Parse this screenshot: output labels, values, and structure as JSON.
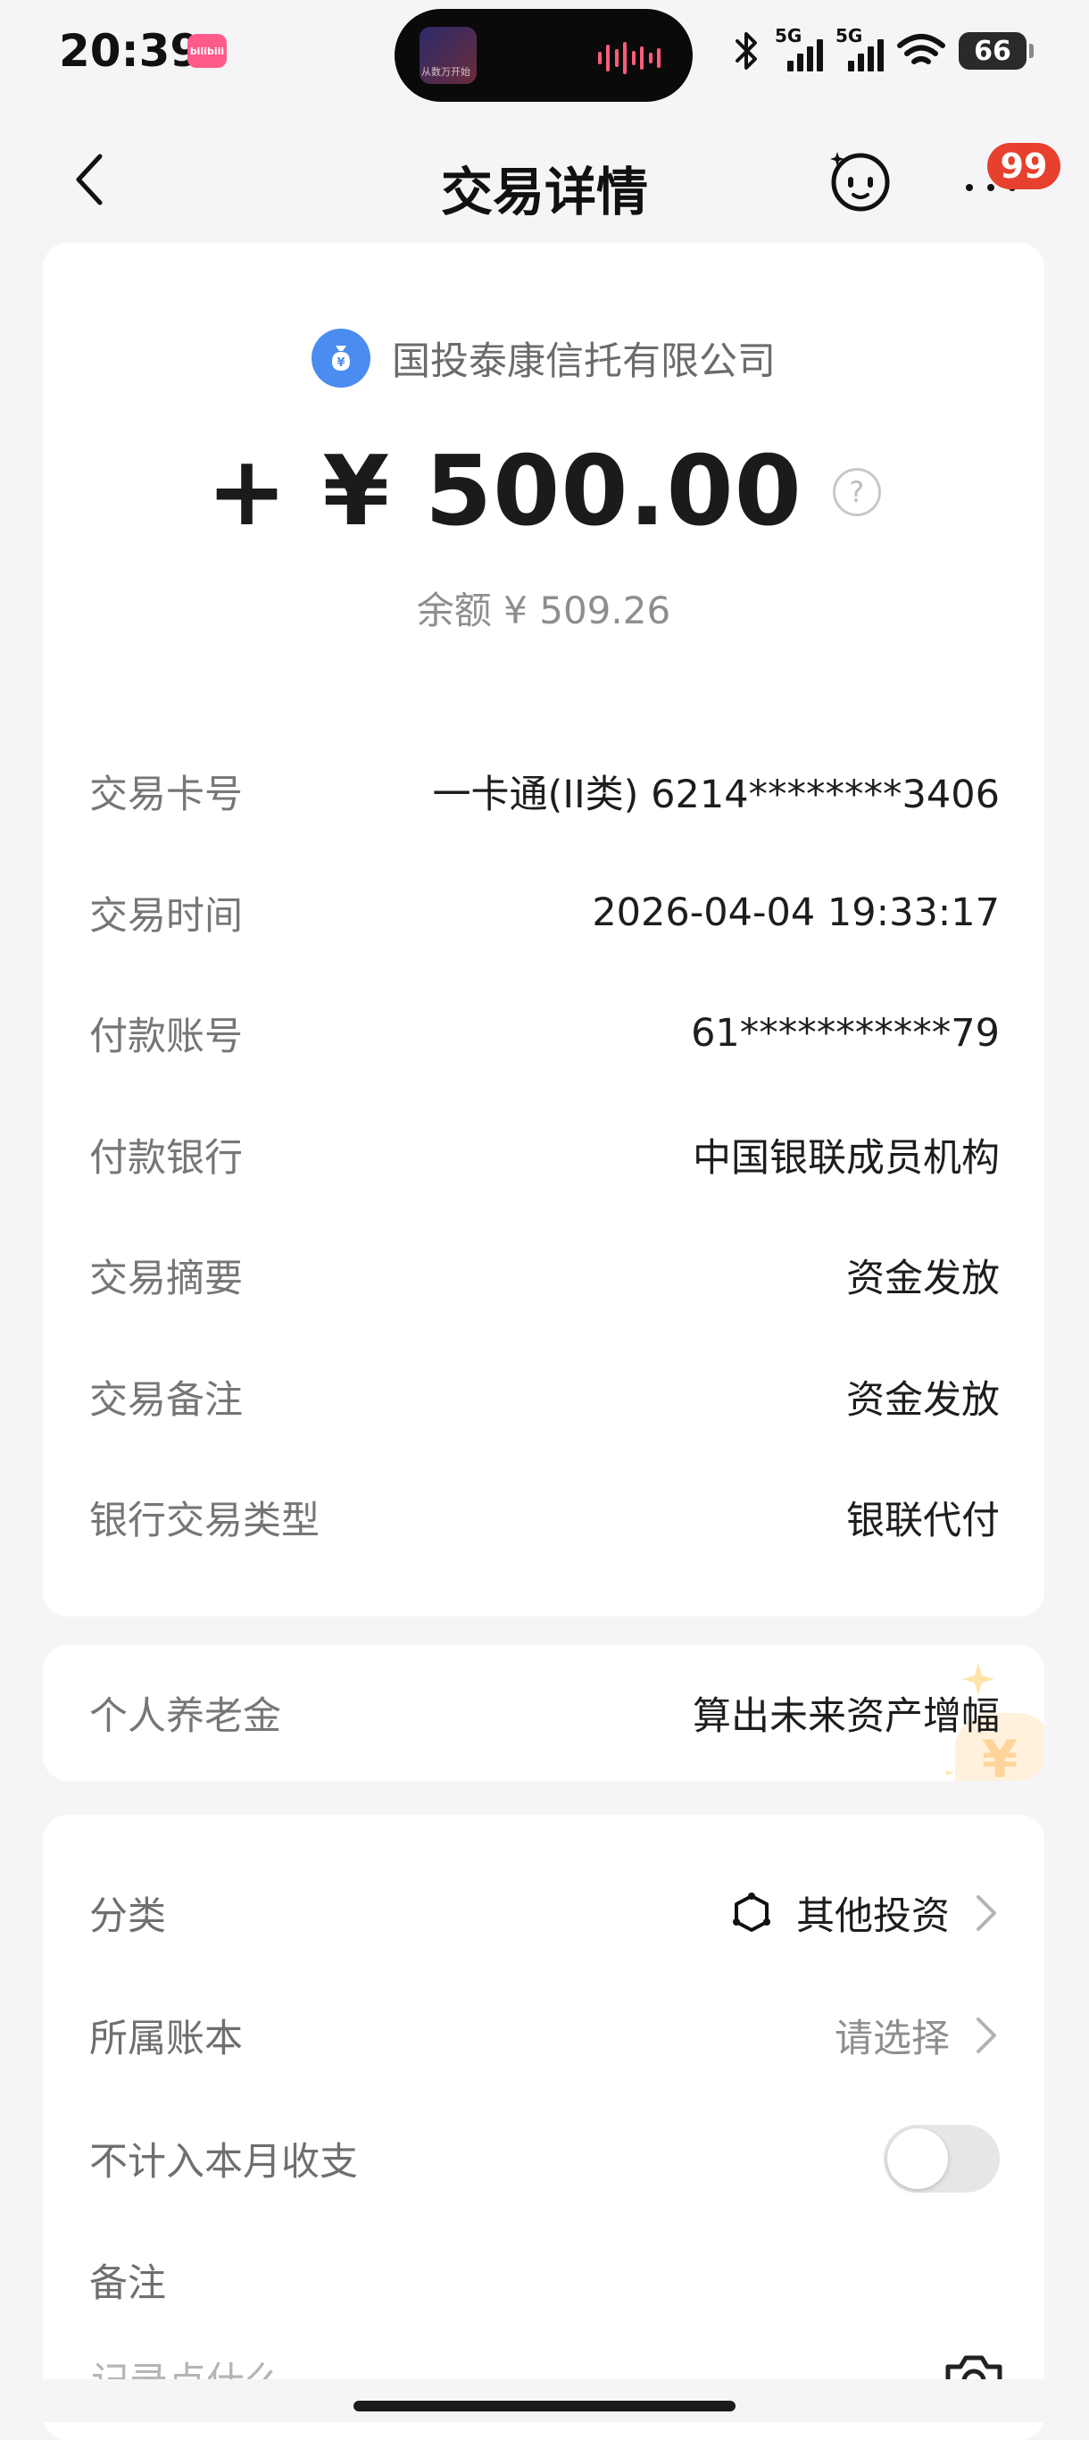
{
  "status_bar": {
    "time": "20:39",
    "app_badge_text": "bilibili",
    "signal_1_label": "5G",
    "signal_2_label": "5G",
    "battery": "66",
    "island_caption": "从数万开始"
  },
  "header": {
    "title": "交易详情",
    "notification_count": "99"
  },
  "transaction": {
    "merchant": "国投泰康信托有限公司",
    "amount": "+ ¥ 500.00",
    "balance": "余额 ¥ 509.26",
    "details": [
      {
        "label": "交易卡号",
        "value": "一卡通(II类) 6214********3406"
      },
      {
        "label": "交易时间",
        "value": "2026-04-04 19:33:17"
      },
      {
        "label": "付款账号",
        "value": "61***********79"
      },
      {
        "label": "付款银行",
        "value": "中国银联成员机构"
      },
      {
        "label": "交易摘要",
        "value": "资金发放"
      },
      {
        "label": "交易备注",
        "value": "资金发放"
      },
      {
        "label": "银行交易类型",
        "value": "银联代付"
      }
    ]
  },
  "pension": {
    "label": "个人养老金",
    "action": "算出未来资产增幅"
  },
  "settings": {
    "category_label": "分类",
    "category_value": "其他投资",
    "ledger_label": "所属账本",
    "ledger_value": "请选择",
    "exclude_label": "不计入本月收支",
    "exclude_enabled": false,
    "memo_label": "备注",
    "memo_placeholder": "记录点什么"
  },
  "colors": {
    "background": "#f5f5f7",
    "card": "#ffffff",
    "badge": "#e8402e",
    "merchant_icon": "#4a8cf0",
    "label": "#767676"
  }
}
